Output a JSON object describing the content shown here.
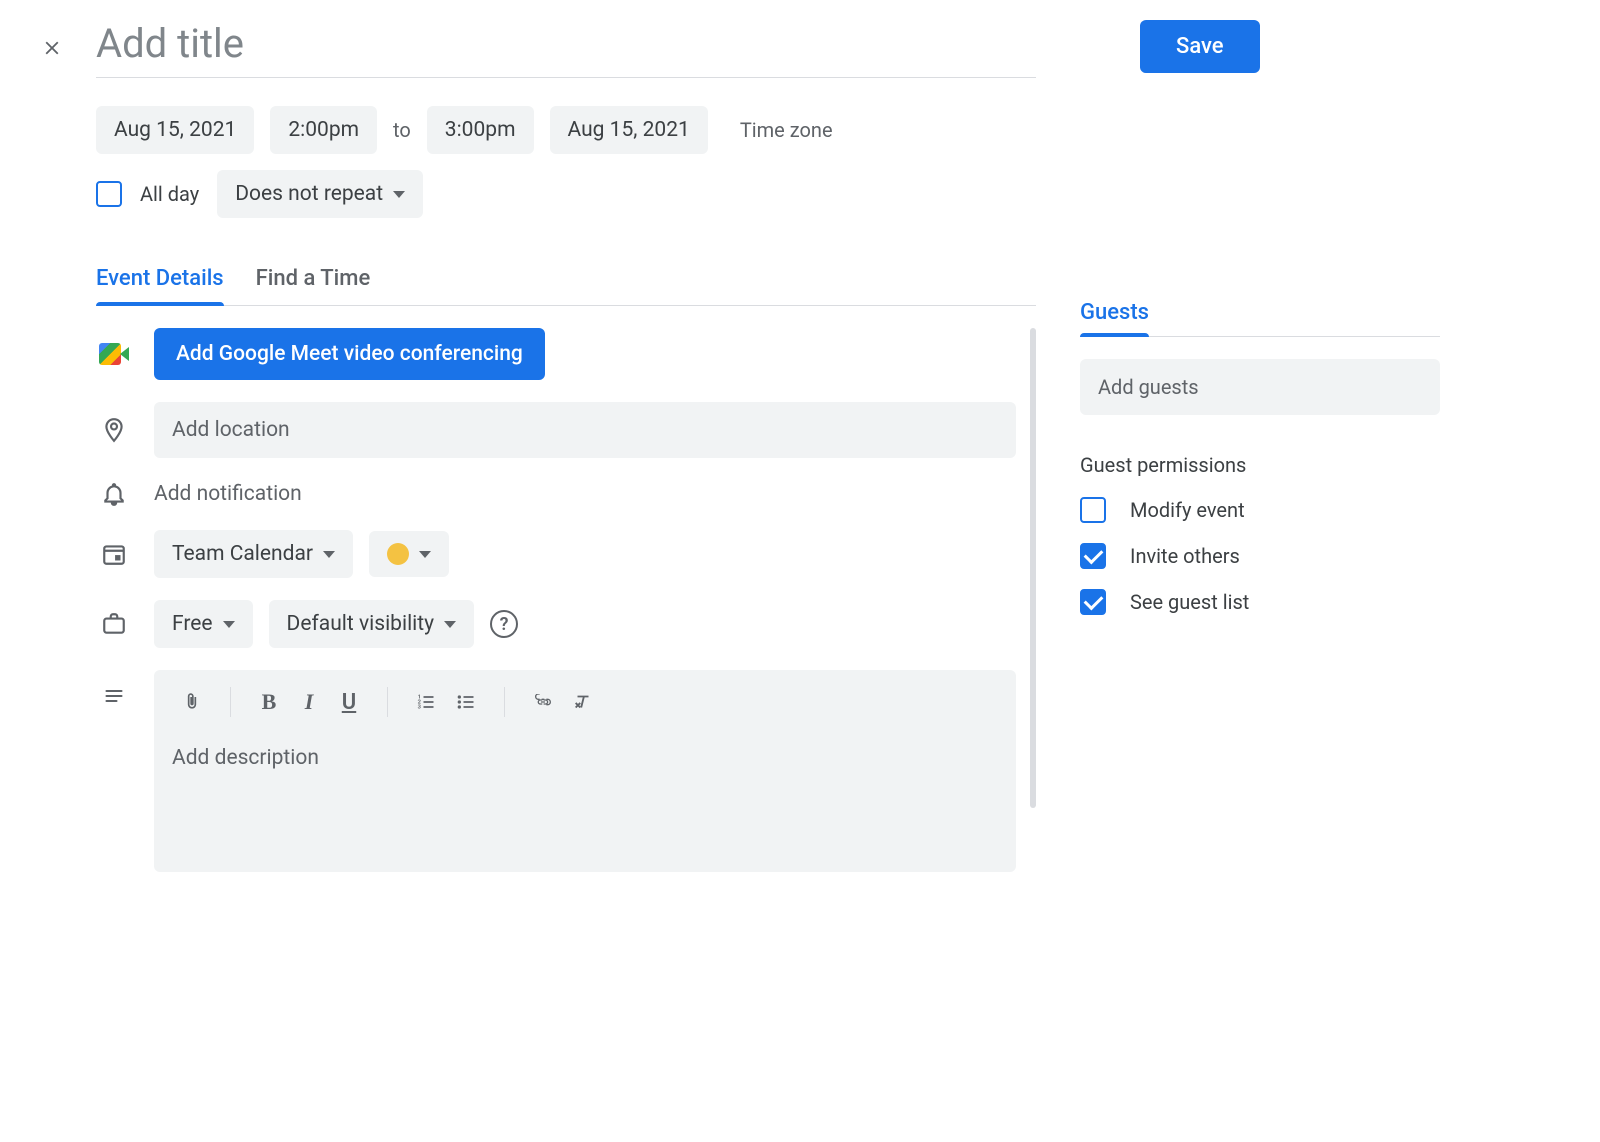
{
  "header": {
    "title_placeholder": "Add title",
    "save_label": "Save"
  },
  "datetime": {
    "start_date": "Aug 15, 2021",
    "start_time": "2:00pm",
    "to_label": "to",
    "end_time": "3:00pm",
    "end_date": "Aug 15, 2021",
    "timezone_label": "Time zone",
    "all_day_label": "All day",
    "all_day_checked": false,
    "repeat_label": "Does not repeat"
  },
  "tabs": {
    "event_details": "Event Details",
    "find_time": "Find a Time"
  },
  "details": {
    "meet_button": "Add Google Meet video conferencing",
    "location_placeholder": "Add location",
    "notification_label": "Add notification",
    "calendar_name": "Team Calendar",
    "busy_label": "Free",
    "visibility_label": "Default visibility",
    "description_placeholder": "Add description"
  },
  "guests": {
    "tab_label": "Guests",
    "input_placeholder": "Add guests",
    "permissions_title": "Guest permissions",
    "perms": [
      {
        "label": "Modify event",
        "checked": false
      },
      {
        "label": "Invite others",
        "checked": true
      },
      {
        "label": "See guest list",
        "checked": true
      }
    ]
  }
}
